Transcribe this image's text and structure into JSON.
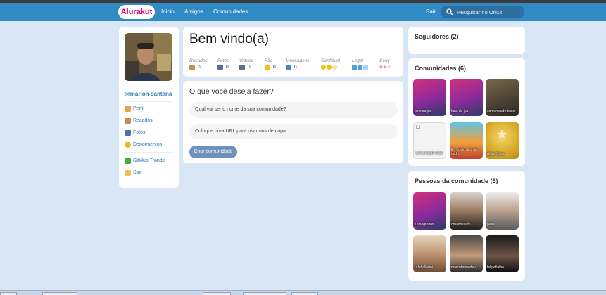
{
  "header": {
    "logo": "Alurakut",
    "nav": [
      "Inicio",
      "Amigos",
      "Comunidades"
    ],
    "logout": "Sair",
    "search_placeholder": "Pesquisar no Orkut"
  },
  "sidebar": {
    "username": "@marlon-santana",
    "links": [
      {
        "label": "Perfil",
        "icon": "user-icon"
      },
      {
        "label": "Recados",
        "icon": "book-icon"
      },
      {
        "label": "Fotos",
        "icon": "camera-icon"
      },
      {
        "label": "Depoimentos",
        "icon": "sun-icon"
      }
    ],
    "extra_links": [
      {
        "label": "GitHub Trends",
        "icon": "plus-icon"
      },
      {
        "label": "Sair",
        "icon": "exit-icon"
      }
    ]
  },
  "welcome": {
    "title": "Bem vindo(a)",
    "stats": [
      {
        "label": "Recados",
        "value": "0",
        "icon": "book-icon"
      },
      {
        "label": "Fotos",
        "value": "0",
        "icon": "camera-icon"
      },
      {
        "label": "Videos",
        "value": "0",
        "icon": "video-icon"
      },
      {
        "label": "Fãs",
        "value": "0",
        "icon": "star-icon"
      },
      {
        "label": "Mensagens",
        "value": "0",
        "icon": "mail-icon"
      }
    ],
    "ratings": [
      {
        "label": "Confiável",
        "icon": "smiley-icon"
      },
      {
        "label": "Legal",
        "icon": "ice-cube-icon"
      },
      {
        "label": "Sexy",
        "icon": "heart-icon"
      }
    ]
  },
  "form": {
    "title": "O que você deseja fazer?",
    "name_placeholder": "Qual vai ser o nome da sua comunidade?",
    "url_placeholder": "Coloque uma URL para usarmos de capa",
    "submit": "Criar comunidade"
  },
  "followers": {
    "title": "Seguidores (2)"
  },
  "communities": {
    "title": "Comunidades (6)",
    "items": [
      "fans da juu",
      "fans da juu",
      "comunidade teste",
      "comunidade teste",
      "Eu odeio acordar cedo",
      "Alura Stars"
    ]
  },
  "people": {
    "title": "Pessoas da comunidade (6)",
    "items": [
      "juunegreiros",
      "omariosouto",
      "peas",
      "rafaballerini",
      "marcobrunodev",
      "felipefialho"
    ]
  },
  "colors": {
    "topbar": "#308bc5",
    "background": "#d9e6f6",
    "link": "#2e7bb4",
    "button": "#6f92bb",
    "logo_text": "#e6007e"
  }
}
